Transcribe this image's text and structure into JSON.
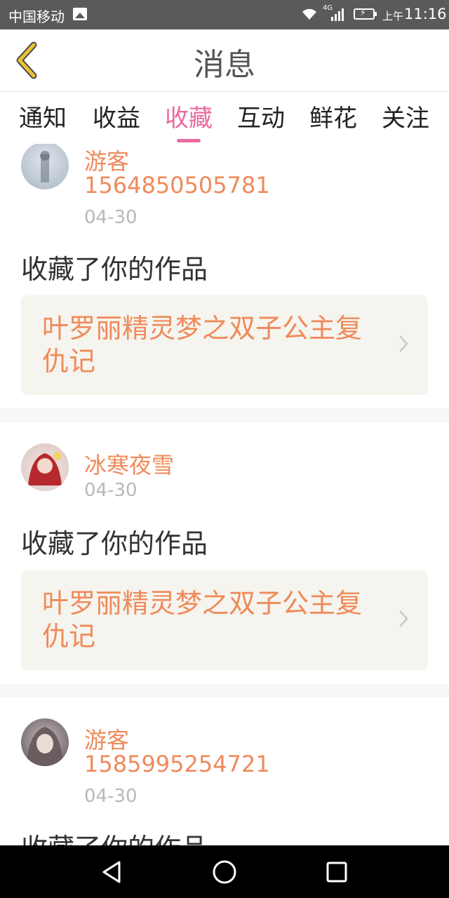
{
  "status": {
    "carrier": "中国移动",
    "network": "4G",
    "ampm": "上午",
    "time": "11:16"
  },
  "header": {
    "title": "消息"
  },
  "tabs": [
    {
      "label": "通知",
      "active": false
    },
    {
      "label": "收益",
      "active": false
    },
    {
      "label": "收藏",
      "active": true
    },
    {
      "label": "互动",
      "active": false
    },
    {
      "label": "鲜花",
      "active": false
    },
    {
      "label": "关注",
      "active": false
    }
  ],
  "items": [
    {
      "username": "游客",
      "user_id": "1564850505781",
      "date": "04-30",
      "action": "收藏了你的作品",
      "work_title": "叶罗丽精灵梦之双子公主复仇记"
    },
    {
      "username": "冰寒夜雪",
      "date": "04-30",
      "action": "收藏了你的作品",
      "work_title": "叶罗丽精灵梦之双子公主复仇记"
    },
    {
      "username": "游客",
      "user_id": "1585995254721",
      "date": "04-30",
      "action": "收藏了你的作品"
    }
  ],
  "colors": {
    "accent": "#e96aa0",
    "name": "#ef8a5a",
    "back_icon": "#e8c436"
  },
  "icons": {
    "back": "back-icon",
    "chevron": "chevron-right-icon",
    "nav": [
      "nav-back-icon",
      "nav-home-icon",
      "nav-recent-icon"
    ]
  }
}
